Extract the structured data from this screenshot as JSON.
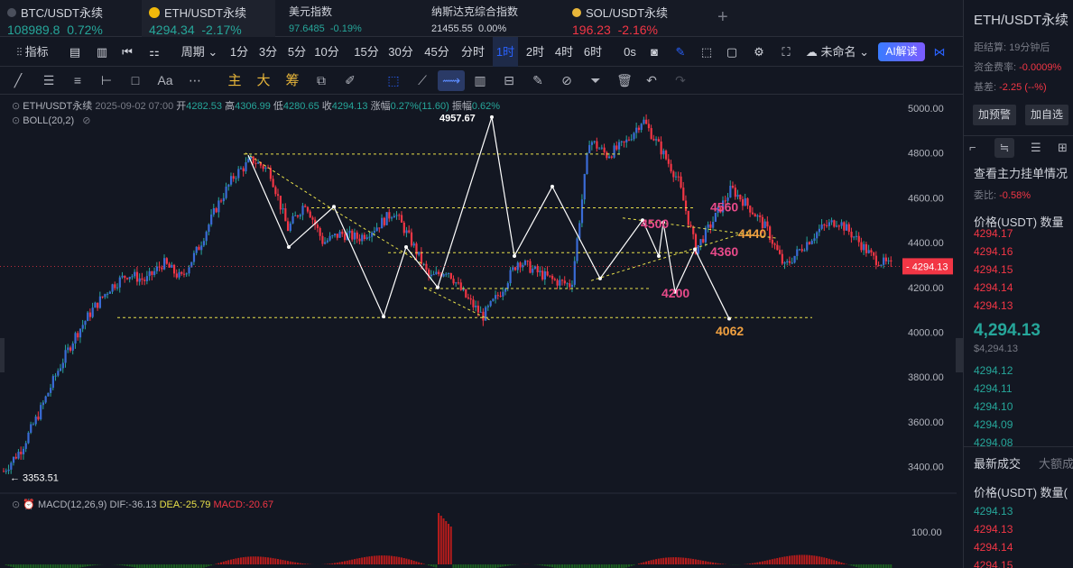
{
  "tabs": [
    {
      "symbol": "BTC/USDT永续",
      "price": "108989.8",
      "change": "0.72%",
      "direction": "up"
    },
    {
      "symbol": "ETH/USDT永续",
      "price": "4294.34",
      "change": "-2.17%",
      "direction": "down"
    },
    {
      "symbol": "美元指数",
      "price": "97.6485",
      "change": "-0.19%",
      "direction": "down"
    },
    {
      "symbol": "纳斯达克综合指数",
      "price": "21455.55",
      "change": "0.00%",
      "direction": "flat"
    },
    {
      "symbol": "SOL/USDT永续",
      "price": "196.23",
      "change": "-2.16%",
      "direction": "down"
    }
  ],
  "add_tab": "+",
  "toolbar": {
    "indicators": "指标",
    "period": "周期",
    "timeframes": [
      "1分",
      "3分",
      "5分",
      "10分",
      "15分",
      "30分",
      "45分",
      "分时",
      "1时",
      "2时",
      "4时",
      "6时",
      "0s"
    ],
    "active_timeframe": "1时",
    "layout_name": "未命名",
    "ai_button": "AI解读"
  },
  "drawing_toolbar": {
    "font_tool": "Aa",
    "cn_tools": [
      "主",
      "大",
      "筹"
    ]
  },
  "legend": {
    "symbol_line": "ETH/USDT永续",
    "datetime": "2025-09-02 07:00",
    "open_label": "开",
    "open": "4282.53",
    "high_label": "高",
    "high": "4306.99",
    "low_label": "低",
    "low": "4280.65",
    "close_label": "收",
    "close": "4294.13",
    "change_label": "涨幅",
    "change": "0.27%(11.60)",
    "amp_label": "振幅",
    "amp": "0.62%",
    "boll": "BOLL(20,2)"
  },
  "macd": {
    "label": "MACD(12,26,9)",
    "dif": "DIF:-36.13",
    "dea": "DEA:-25.79",
    "macd": "MACD:-20.67",
    "axis_label": "100.00"
  },
  "chart_data": {
    "type": "candlestick",
    "y_ticks": [
      "5000.00",
      "4800.00",
      "4600.00",
      "4400.00",
      "4200.00",
      "4000.00",
      "3800.00",
      "3600.00",
      "3400.00"
    ],
    "y_values": [
      5000,
      4800,
      4600,
      4400,
      4200,
      4000,
      3800,
      3600,
      3400
    ],
    "ylim": [
      3330,
      5060
    ],
    "current_price": "4294.13",
    "high_marker": "4957.67",
    "low_marker": "3353.51",
    "annotations": [
      {
        "text": "4560",
        "value": 4560,
        "color": "#e84a8a"
      },
      {
        "text": "4500",
        "value": 4500,
        "color": "#e84a8a"
      },
      {
        "text": "4440",
        "value": 4440,
        "color": "#f0a040"
      },
      {
        "text": "4360",
        "value": 4360,
        "color": "#e84a8a"
      },
      {
        "text": "4200",
        "value": 4200,
        "color": "#e84a8a"
      },
      {
        "text": "4062",
        "value": 4062,
        "color": "#f0a040"
      }
    ],
    "levels": [
      4795,
      4555,
      4355,
      4195,
      4065
    ],
    "price_path": [
      3380,
      3480,
      3640,
      3820,
      3980,
      4100,
      4200,
      4260,
      4230,
      4310,
      4240,
      4380,
      4560,
      4700,
      4770,
      4720,
      4460,
      4580,
      4400,
      4440,
      4420,
      4470,
      4540,
      4400,
      4240,
      4280,
      4160,
      4070,
      4180,
      4320,
      4270,
      4230,
      4210,
      4860,
      4790,
      4840,
      4950,
      4820,
      4680,
      4370,
      4500,
      4640,
      4560,
      4460,
      4290,
      4380,
      4460,
      4500,
      4420,
      4330,
      4294
    ],
    "colors": {
      "up": "#26a69a",
      "down": "#f23645",
      "level_line": "#e8e04a",
      "path": "#ffffff"
    }
  },
  "sidebar": {
    "title": "ETH/USDT永续",
    "settle_label": "距结算:",
    "settle": "19分钟后",
    "funding_label": "资金费率:",
    "funding": "-0.0009%",
    "basis_label": "基差:",
    "basis": "-2.25 (--%)",
    "btn_alert": "加预警",
    "btn_watch": "加自选",
    "order_title": "查看主力挂单情况",
    "ratio_label": "委比:",
    "ratio": "-0.58%",
    "col_price": "价格(USDT)",
    "col_qty": "数量",
    "asks": [
      "4294.17",
      "4294.16",
      "4294.15",
      "4294.14",
      "4294.13"
    ],
    "last_price": "4,294.13",
    "last_usd": "$4,294.13",
    "bids": [
      "4294.12",
      "4294.11",
      "4294.10",
      "4294.09",
      "4294.08"
    ],
    "trades_tab": "最新成交",
    "large_tab": "大额成",
    "trades_col_price": "价格(USDT)",
    "trades_col_qty": "数量(",
    "trades": [
      {
        "price": "4294.13",
        "side": "buy"
      },
      {
        "price": "4294.13",
        "side": "sell"
      },
      {
        "price": "4294.14",
        "side": "sell"
      },
      {
        "price": "4294.15",
        "side": "sell"
      }
    ]
  }
}
